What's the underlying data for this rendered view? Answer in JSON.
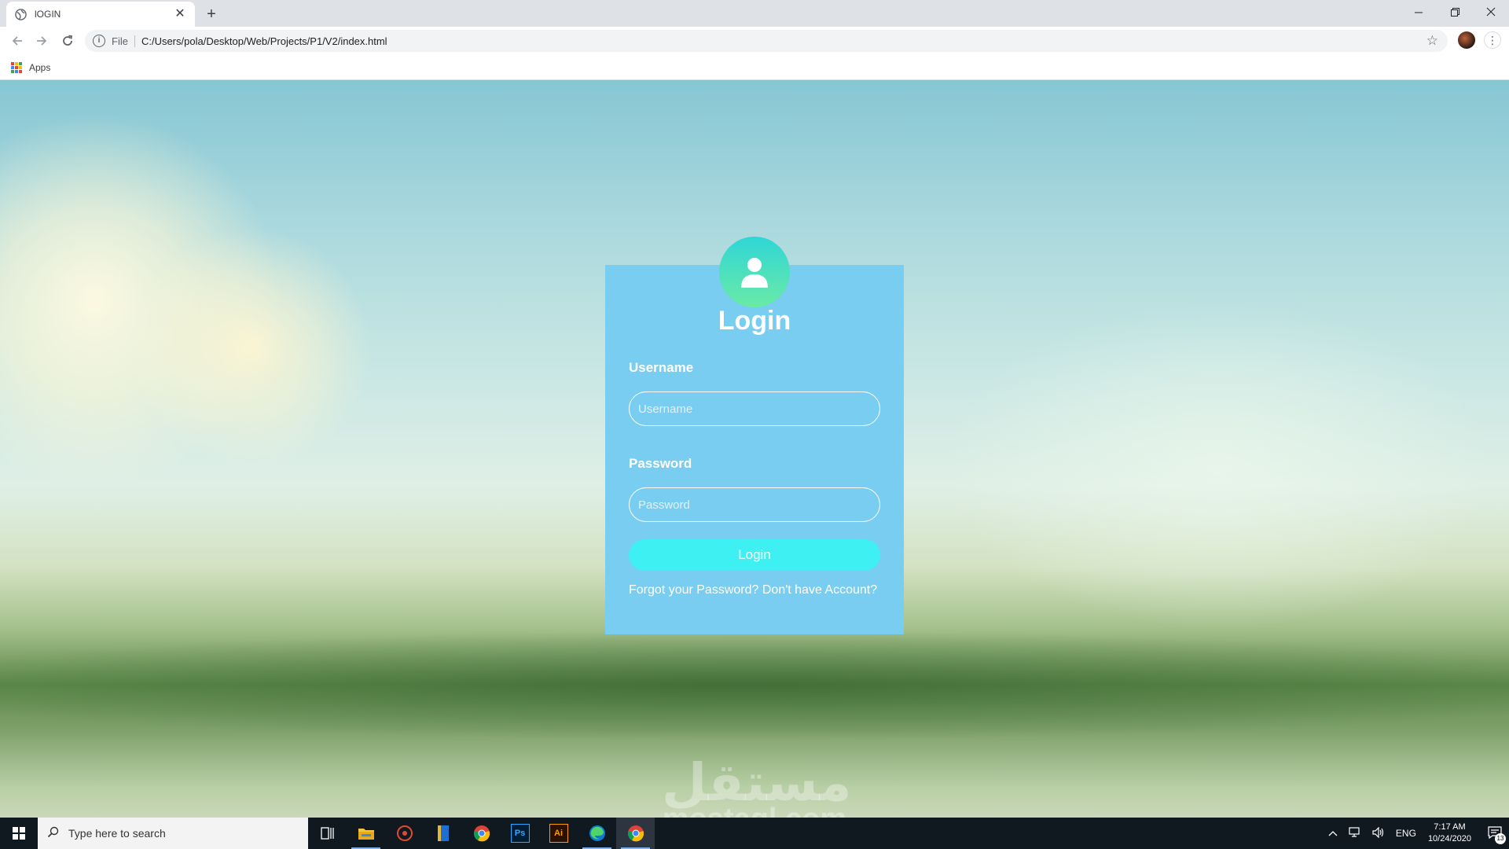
{
  "browser": {
    "tab_title": "lOGIN",
    "tab_close": "✕",
    "new_tab": "+",
    "omnibox_scheme": "File",
    "url": "C:/Users/pola/Desktop/Web/Projects/P1/V2/index.html",
    "bookmarks": {
      "apps_label": "Apps"
    }
  },
  "login": {
    "title": "Login",
    "username_label": "Username",
    "username_placeholder": "Username",
    "password_label": "Password",
    "password_placeholder": "Password",
    "button_label": "Login",
    "forgot_link": "Forgot your Password?",
    "signup_link": "Don't have Account?"
  },
  "watermark": {
    "arabic": "مستقل",
    "latin": "mostaql.com"
  },
  "taskbar": {
    "search_placeholder": "Type here to search",
    "language": "ENG",
    "time": "7:17 AM",
    "date": "10/24/2020",
    "notification_count": "13"
  },
  "colors": {
    "card": "#79cdf0",
    "button": "#3ef0f2",
    "avatar_top": "#2fd6d6",
    "avatar_bottom": "#6aeaa6",
    "taskbar": "#101820"
  }
}
